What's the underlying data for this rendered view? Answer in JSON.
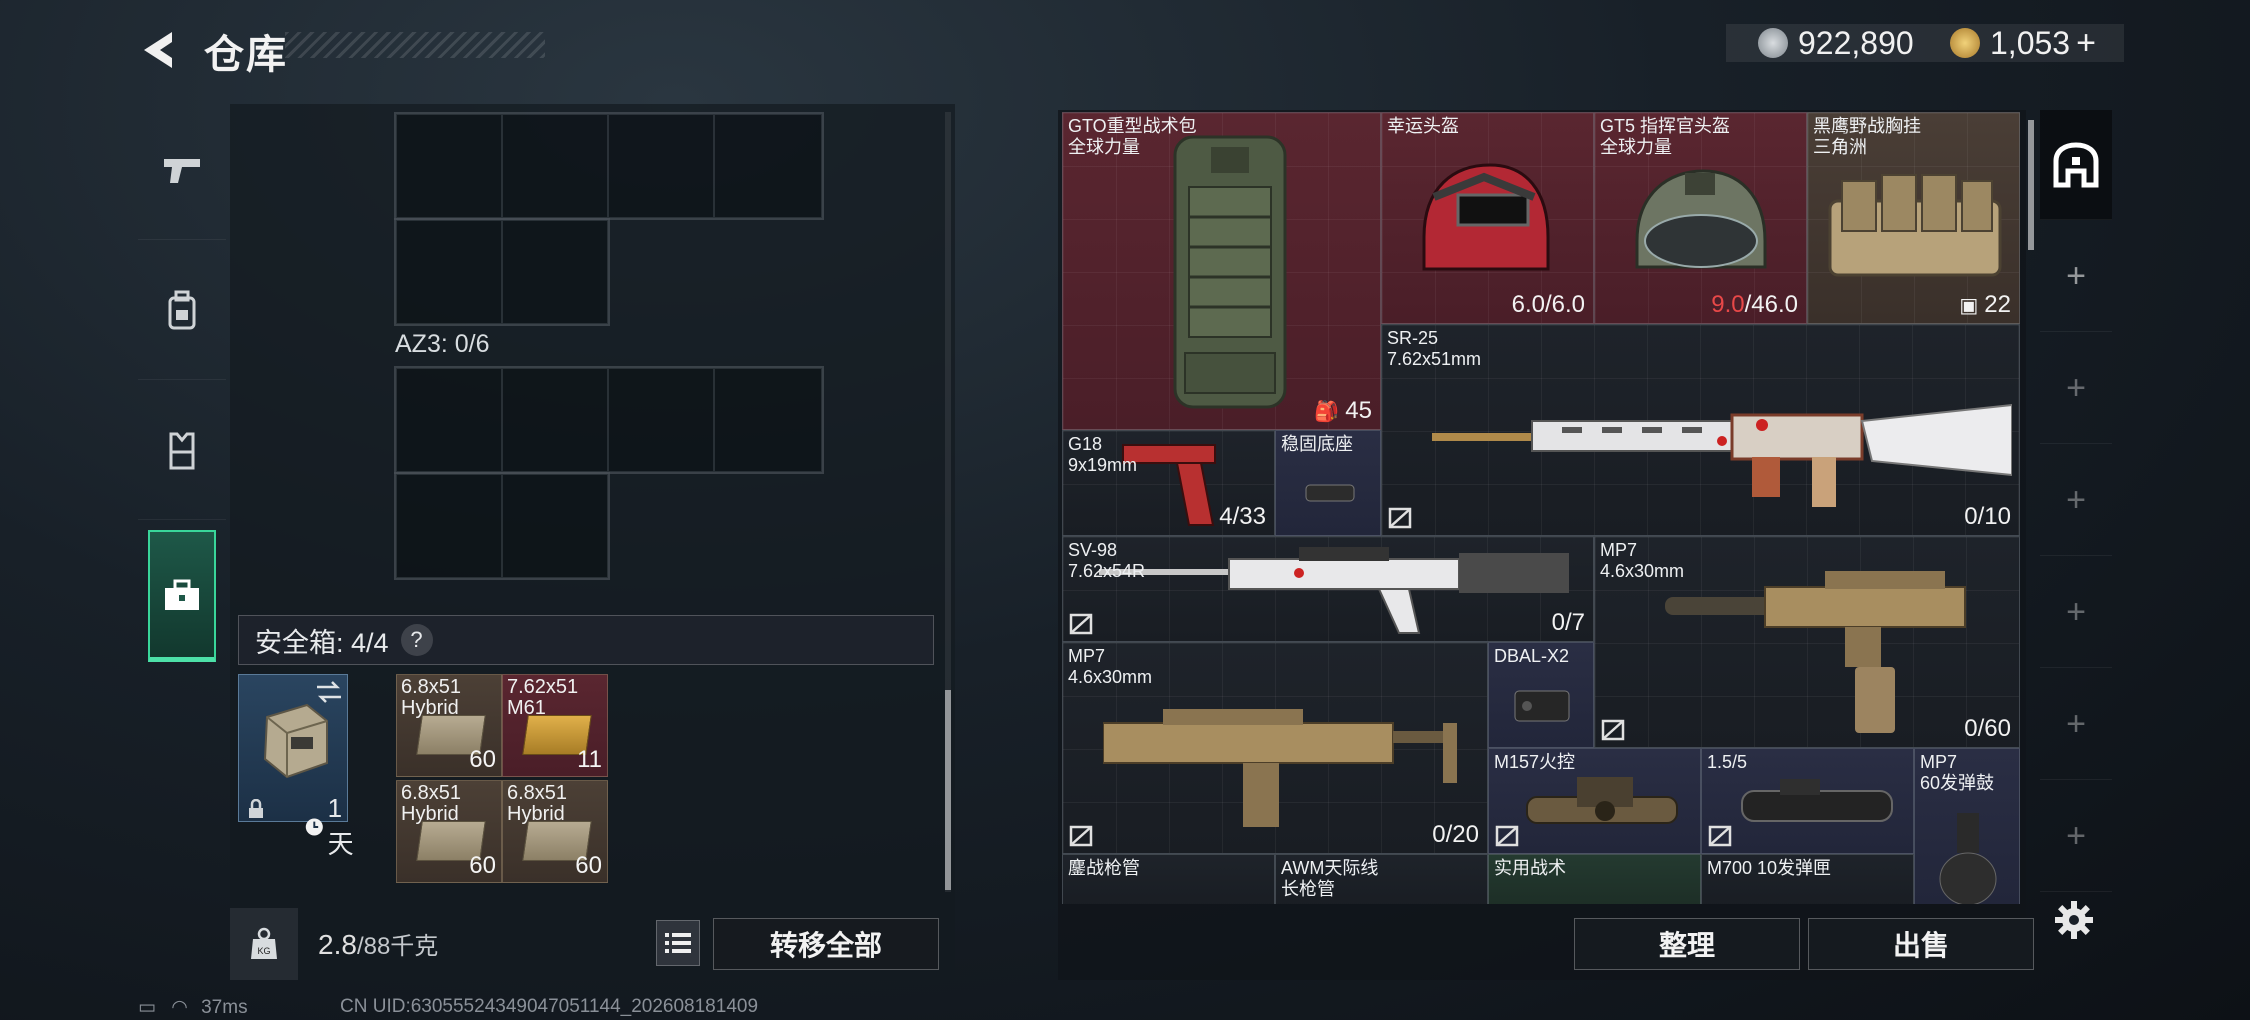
{
  "header": {
    "title": "仓库",
    "currency_silver": "922,890",
    "currency_gold": "1,053",
    "gold_add": "+"
  },
  "left_nav": [
    {
      "icon": "pistol-icon"
    },
    {
      "icon": "backpack-icon"
    },
    {
      "icon": "vest-icon"
    },
    {
      "icon": "toolbox-icon",
      "active": true
    }
  ],
  "container": {
    "az3_label": "AZ3: 0/6",
    "safe_label": "安全箱: 4/4",
    "help": "?",
    "safe_timer": "1天",
    "ammo": [
      {
        "name": "6.8x51\nHybrid",
        "count": "60"
      },
      {
        "name": "7.62x51\nM61",
        "count": "11"
      },
      {
        "name": "6.8x51\nHybrid",
        "count": "60"
      },
      {
        "name": "6.8x51\nHybrid",
        "count": "60"
      }
    ]
  },
  "footer_left": {
    "weight_value": "2.8",
    "weight_unit": "/88千克",
    "transfer_all": "转移全部"
  },
  "stash": [
    {
      "key": "gto",
      "name": "GTO重型战术包\n全球力量",
      "qty": "45"
    },
    {
      "key": "lucky",
      "name": "幸运头盔",
      "qty": "6.0/6.0"
    },
    {
      "key": "gt5",
      "name": "GT5 指挥官头盔\n全球力量",
      "qty_hl": "9.0",
      "qty": "/46.0"
    },
    {
      "key": "eagle",
      "name": "黑鹰野战胸挂\n三角洲",
      "qty": "22"
    },
    {
      "key": "sr25",
      "name": "SR-25\n7.62x51mm",
      "qty": "0/10"
    },
    {
      "key": "g18",
      "name": "G18\n9x19mm",
      "qty": "4/33"
    },
    {
      "key": "base",
      "name": "稳固底座",
      "qty": ""
    },
    {
      "key": "sv98",
      "name": "SV-98\n7.62x54R",
      "qty": "0/7"
    },
    {
      "key": "mp7a",
      "name": "MP7\n4.6x30mm",
      "qty": "0/60"
    },
    {
      "key": "mp7b",
      "name": "MP7\n4.6x30mm",
      "qty": "0/20"
    },
    {
      "key": "dbal",
      "name": "DBAL-X2",
      "qty": ""
    },
    {
      "key": "m157",
      "name": "M157火控",
      "qty": ""
    },
    {
      "key": "scope",
      "name": "1.5/5",
      "qty": ""
    },
    {
      "key": "mp7mag",
      "name": "MP7\n60发弹鼓",
      "qty": ""
    },
    {
      "key": "r1",
      "name": "鏖战枪管",
      "qty": ""
    },
    {
      "key": "r2",
      "name": "AWM天际线\n长枪管",
      "qty": ""
    },
    {
      "key": "r3",
      "name": "实用战术",
      "qty": ""
    },
    {
      "key": "r4",
      "name": "M700 10发弹匣",
      "qty": ""
    }
  ],
  "footer_right": {
    "sort": "整理",
    "sell": "出售"
  },
  "status": {
    "ping": "37ms",
    "uid": "CN UID:63055524349047051144_202608181409"
  },
  "colors": {
    "accent": "#39d69a",
    "red_rarity": "#5a2630",
    "gold_rarity": "#4a3e36",
    "blue_rarity": "#2a2e44",
    "warning": "#e84848"
  }
}
